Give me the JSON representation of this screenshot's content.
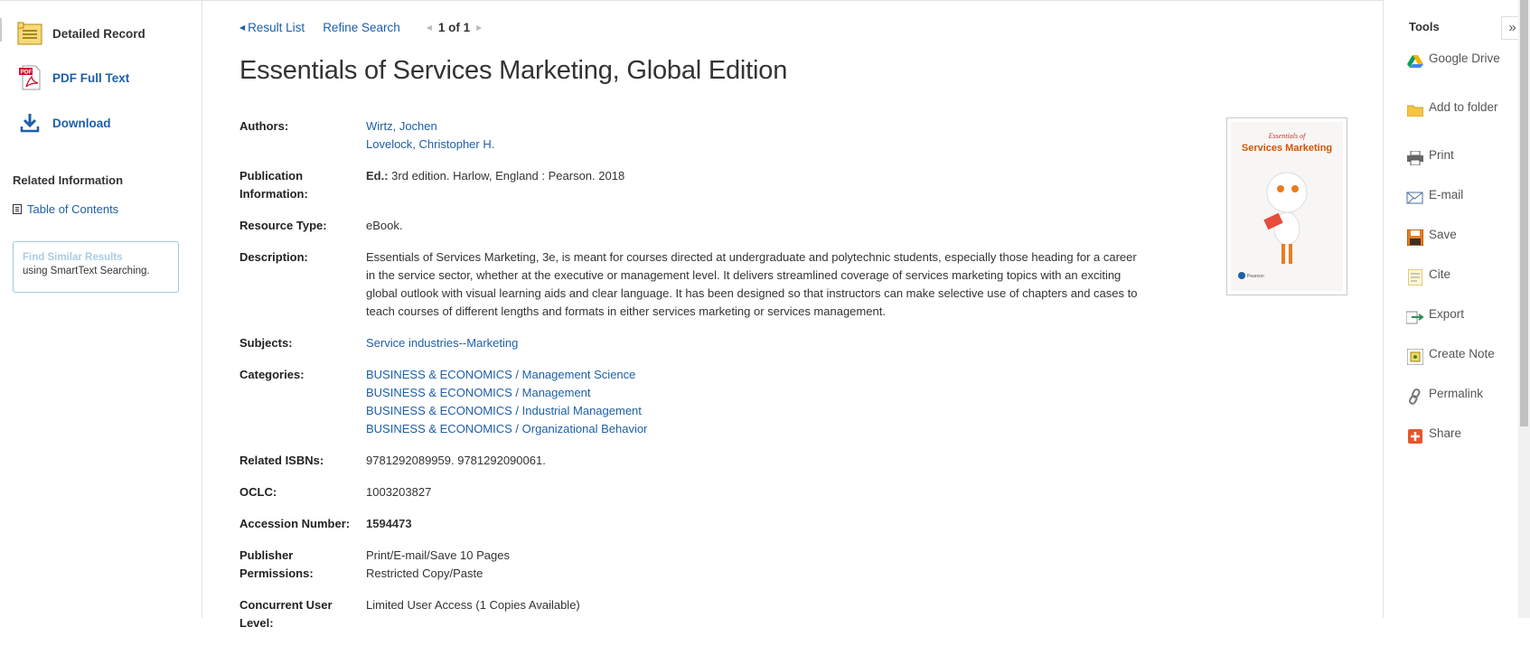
{
  "left": {
    "formats": [
      {
        "label": "Detailed Record",
        "icon": "detailed-record-icon"
      },
      {
        "label": "PDF Full Text",
        "icon": "pdf-icon"
      },
      {
        "label": "Download",
        "icon": "download-icon"
      }
    ],
    "related_heading": "Related Information",
    "toc_label": "Table of Contents",
    "similar": {
      "title": "Find Similar Results",
      "subtitle": "using SmartText Searching."
    }
  },
  "nav": {
    "result_list": "Result List",
    "refine": "Refine Search",
    "pager": "1 of 1"
  },
  "record": {
    "title": "Essentials of Services Marketing, Global Edition",
    "fields": {
      "authors_label": "Authors:",
      "authors": [
        "Wirtz, Jochen",
        "Lovelock, Christopher H."
      ],
      "pub_label_1": "Publication",
      "pub_label_2": "Information:",
      "pub_ed": "Ed.:",
      "pub_value": " 3rd edition. Harlow, England : Pearson. 2018",
      "rtype_label": "Resource Type:",
      "rtype_value": "eBook.",
      "desc_label": "Description:",
      "desc_value": "Essentials of Services Marketing, 3e, is meant for courses directed at undergraduate and polytechnic students, especially those heading for a career in the service sector, whether at the executive or management level. It delivers streamlined coverage of services marketing topics with an exciting global outlook with visual learning aids and clear language. It has been designed so that instructors can make selective use of chapters and cases to teach courses of different lengths and formats in either services marketing or services management.",
      "subjects_label": "Subjects:",
      "subjects_value": "Service industries--Marketing",
      "categories_label": "Categories:",
      "categories": [
        "BUSINESS & ECONOMICS / Management Science",
        "BUSINESS & ECONOMICS / Management",
        "BUSINESS & ECONOMICS / Industrial Management",
        "BUSINESS & ECONOMICS / Organizational Behavior"
      ],
      "isbn_label": "Related ISBNs:",
      "isbn_value": "9781292089959. 9781292090061.",
      "oclc_label": "OCLC:",
      "oclc_value": "1003203827",
      "accession_label": "Accession Number:",
      "accession_value": "1594473",
      "perm_label_1": "Publisher",
      "perm_label_2": "Permissions:",
      "perm_values": [
        "Print/E-mail/Save 10 Pages",
        "Restricted Copy/Paste"
      ],
      "users_label_1": "Concurrent User",
      "users_label_2": "Level:",
      "users_value": "Limited User Access (1 Copies Available)"
    },
    "cover": {
      "line1": "Essentials of",
      "line2": "Services Marketing",
      "publisher": "Pearson"
    }
  },
  "tools": {
    "heading": "Tools",
    "collapse": "»",
    "items": [
      {
        "label": "Google Drive",
        "icon": "google-drive-icon"
      },
      {
        "label": "Add to folder",
        "icon": "folder-icon"
      },
      {
        "label": "Print",
        "icon": "printer-icon"
      },
      {
        "label": "E-mail",
        "icon": "email-icon"
      },
      {
        "label": "Save",
        "icon": "save-icon"
      },
      {
        "label": "Cite",
        "icon": "cite-icon"
      },
      {
        "label": "Export",
        "icon": "export-icon"
      },
      {
        "label": "Create Note",
        "icon": "note-icon"
      },
      {
        "label": "Permalink",
        "icon": "link-icon"
      },
      {
        "label": "Share",
        "icon": "share-icon"
      }
    ]
  },
  "colors": {
    "link": "#1d5fa8",
    "text": "#333333",
    "border": "#e3e3e3",
    "similar_border": "#9ccbe6"
  }
}
